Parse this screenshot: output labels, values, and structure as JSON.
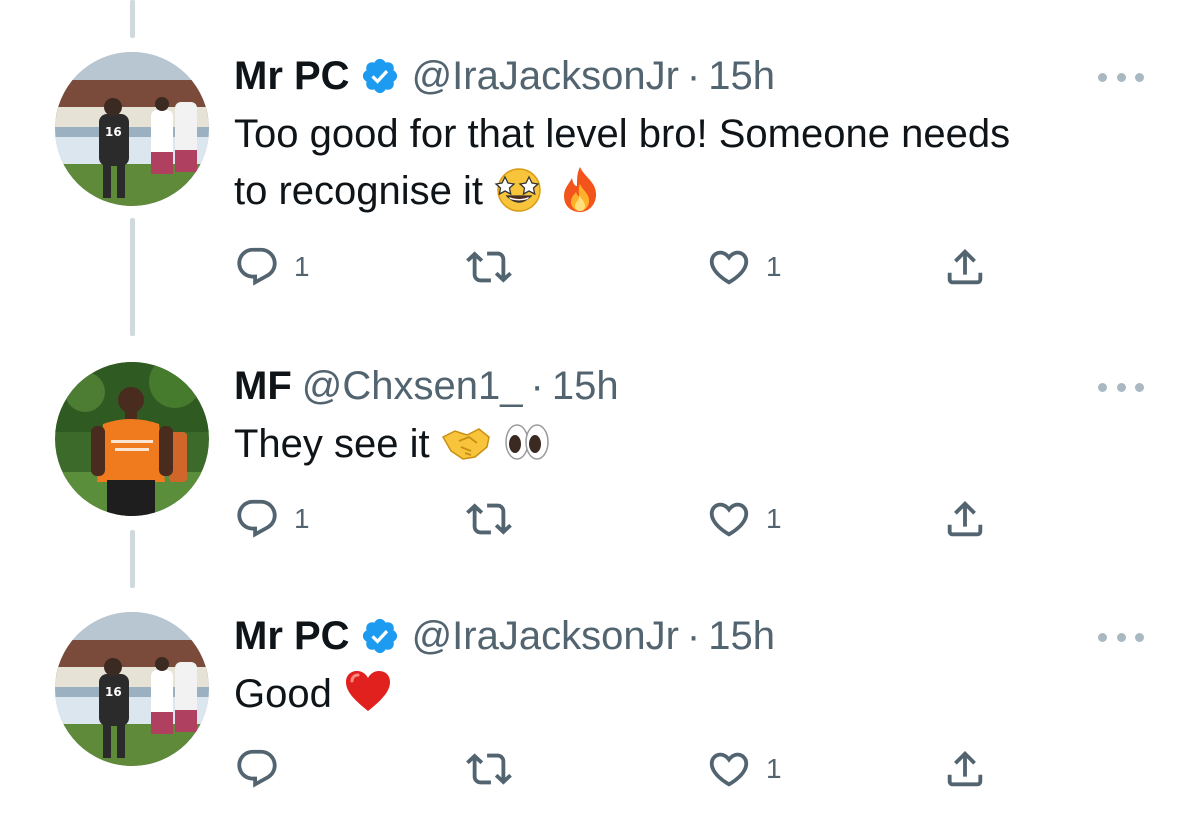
{
  "tweets": [
    {
      "name": "Mr PC",
      "verified": true,
      "handle": "@IraJacksonJr",
      "separator": "·",
      "time": "15h",
      "text_line1": "Too good for that level bro! Someone needs",
      "text_line2": "to recognise it",
      "emojis": [
        "star-struck",
        "fire"
      ],
      "reply_count": "1",
      "retweet_count": "",
      "like_count": "1"
    },
    {
      "name": "MF",
      "verified": false,
      "handle": "@Chxsen1_",
      "separator": "·",
      "time": "15h",
      "text_line1": "They see it",
      "emojis": [
        "handshake",
        "eyes"
      ],
      "reply_count": "1",
      "retweet_count": "",
      "like_count": "1"
    },
    {
      "name": "Mr PC",
      "verified": true,
      "handle": "@IraJacksonJr",
      "separator": "·",
      "time": "15h",
      "text_line1": "Good",
      "emojis": [
        "red-heart"
      ],
      "reply_count": "",
      "retweet_count": "",
      "like_count": "1"
    }
  ],
  "colors": {
    "text": "#0f1419",
    "secondary": "#536471",
    "verified": "#1d9bf0",
    "thread_line": "#cfd9de"
  },
  "icons": [
    "reply-icon",
    "retweet-icon",
    "like-icon",
    "share-icon",
    "more-icon",
    "verified-badge-icon"
  ]
}
